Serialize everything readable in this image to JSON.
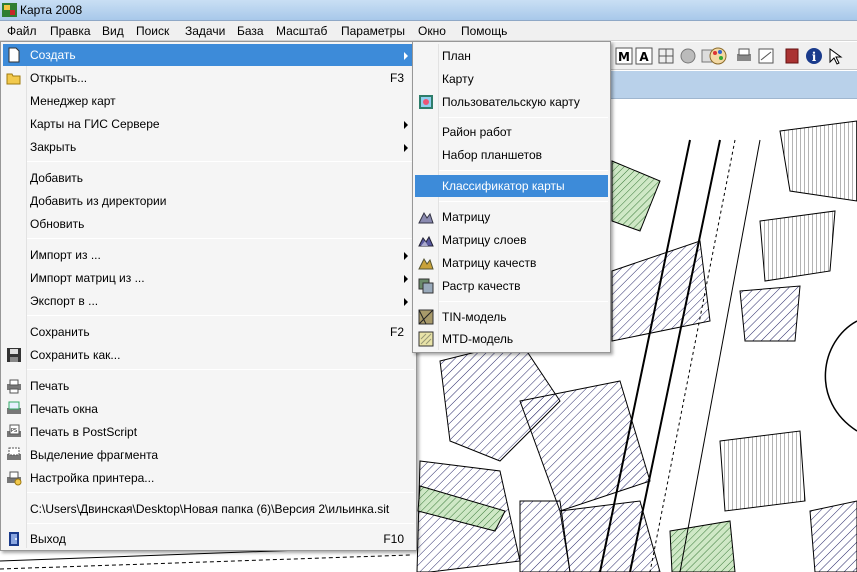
{
  "window": {
    "title": "Карта 2008"
  },
  "menubar": [
    {
      "label": "Файл"
    },
    {
      "label": "Правка"
    },
    {
      "label": "Вид"
    },
    {
      "label": "Поиск"
    },
    {
      "label": "Задачи"
    },
    {
      "label": "База"
    },
    {
      "label": "Масштаб"
    },
    {
      "label": "Параметры"
    },
    {
      "label": "Окно"
    },
    {
      "label": "Помощь"
    }
  ],
  "file_menu": {
    "items": [
      {
        "label": "Создать",
        "icon": "new-document-icon",
        "submenu": true
      },
      {
        "label": "Открыть...",
        "icon": "open-folder-icon",
        "shortcut": "F3"
      },
      {
        "label": "Менеджер карт"
      },
      {
        "label": "Карты на ГИС Сервере",
        "submenu": true
      },
      {
        "label": "Закрыть",
        "submenu": true
      },
      {
        "label": "Добавить"
      },
      {
        "label": "Добавить из директории"
      },
      {
        "label": "Обновить"
      },
      {
        "label": "Импорт из ...",
        "submenu": true
      },
      {
        "label": "Импорт матриц из ...",
        "submenu": true
      },
      {
        "label": "Экспорт в ...",
        "submenu": true
      },
      {
        "label": "Сохранить",
        "shortcut": "F2"
      },
      {
        "label": "Сохранить как...",
        "icon": "floppy-disk-icon"
      },
      {
        "label": "Печать",
        "icon": "printer-icon"
      },
      {
        "label": "Печать окна",
        "icon": "print-window-icon"
      },
      {
        "label": "Печать в PostScript",
        "icon": "print-postscript-icon"
      },
      {
        "label": "Выделение фрагмента",
        "icon": "select-fragment-icon"
      },
      {
        "label": "Настройка принтера...",
        "icon": "printer-settings-icon"
      },
      {
        "label": "C:\\Users\\Двинская\\Desktop\\Новая папка (6)\\Версия 2\\ильинка.sit"
      },
      {
        "label": "Выход",
        "icon": "exit-door-icon",
        "shortcut": "F10"
      }
    ]
  },
  "create_submenu": {
    "items": [
      {
        "label": "План"
      },
      {
        "label": "Карту"
      },
      {
        "label": "Пользовательскую карту",
        "icon": "user-map-icon"
      },
      {
        "label": "Район работ"
      },
      {
        "label": "Набор планшетов"
      },
      {
        "label": "Классификатор карты"
      },
      {
        "label": "Матрицу",
        "icon": "matrix-icon"
      },
      {
        "label": "Матрицу слоев",
        "icon": "matrix-layers-icon"
      },
      {
        "label": "Матрицу качеств",
        "icon": "matrix-quality-icon"
      },
      {
        "label": "Растр качеств",
        "icon": "raster-quality-icon"
      },
      {
        "label": "TIN-модель",
        "icon": "tin-model-icon"
      },
      {
        "label": "MTD-модель",
        "icon": "mtd-model-icon"
      }
    ]
  },
  "colors": {
    "highlight": "#3d8bd9",
    "menu_bg": "#f5f5f5",
    "titlebar": "#b9d1ea"
  }
}
